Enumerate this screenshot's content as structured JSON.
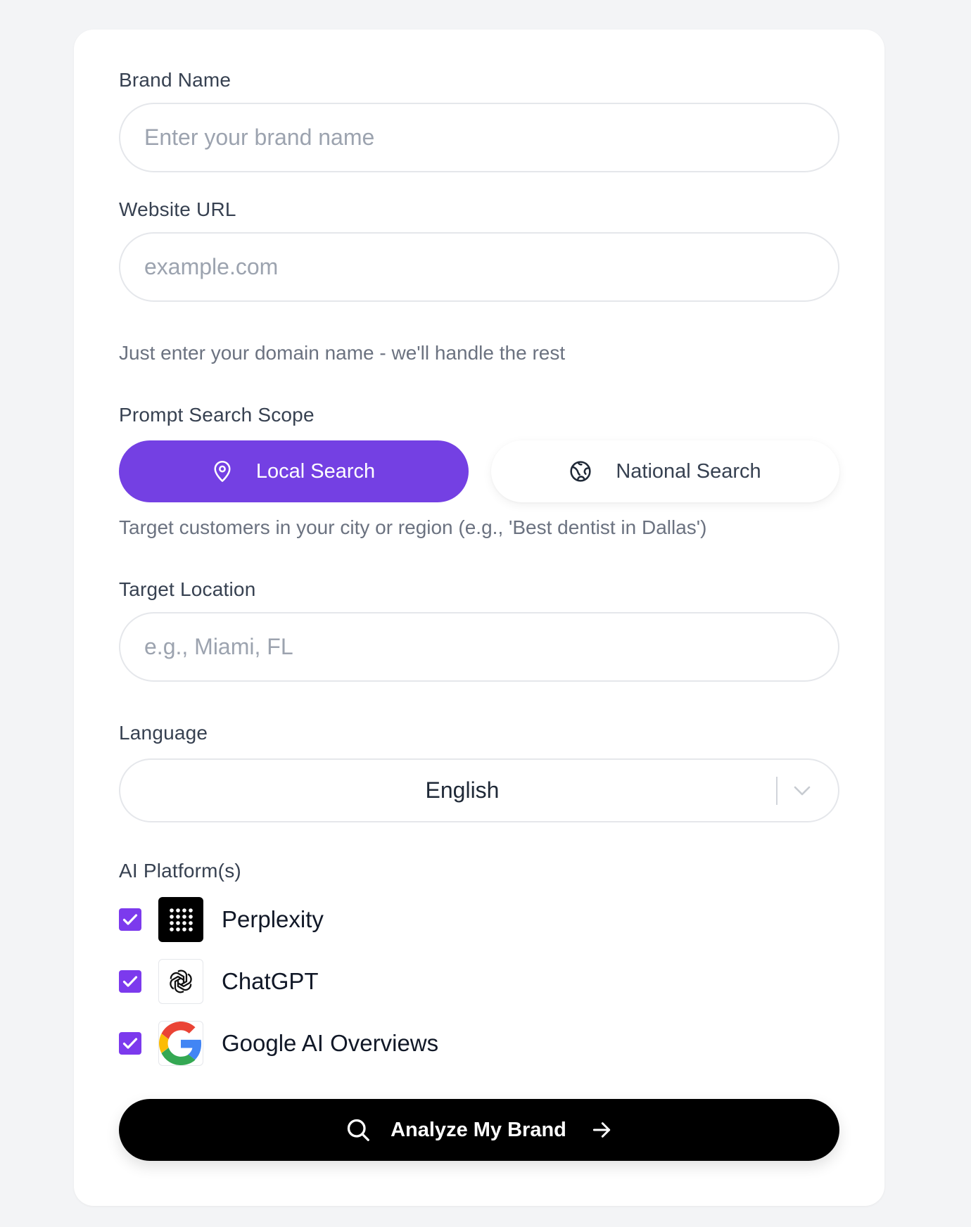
{
  "form": {
    "brand_name": {
      "label": "Brand Name",
      "placeholder": "Enter your brand name",
      "value": ""
    },
    "website_url": {
      "label": "Website URL",
      "placeholder": "example.com",
      "value": "",
      "hint": "Just enter your domain name - we'll handle the rest"
    },
    "scope": {
      "label": "Prompt Search Scope",
      "local_label": "Local Search",
      "national_label": "National Search",
      "selected": "local",
      "hint": "Target customers in your city or region (e.g., 'Best dentist in Dallas')",
      "local_icon": "map-pin-icon",
      "national_icon": "globe-icon"
    },
    "target_location": {
      "label": "Target Location",
      "placeholder": "e.g., Miami, FL",
      "value": ""
    },
    "language": {
      "label": "Language",
      "selected": "English"
    },
    "platforms": {
      "label": "AI Platform(s)",
      "items": [
        {
          "name": "Perplexity",
          "checked": true,
          "icon": "perplexity-logo-icon"
        },
        {
          "name": "ChatGPT",
          "checked": true,
          "icon": "chatgpt-logo-icon"
        },
        {
          "name": "Google AI Overviews",
          "checked": true,
          "icon": "google-logo-icon"
        }
      ]
    },
    "submit_label": "Analyze My Brand"
  },
  "colors": {
    "page_bg": "#f3f4f6",
    "accent_purple": "#7440e3",
    "checkbox_purple": "#7c3aed",
    "cta_bg": "#000000",
    "border": "#e5e7eb",
    "muted_text": "#6b7280",
    "placeholder": "#9ca3af"
  }
}
